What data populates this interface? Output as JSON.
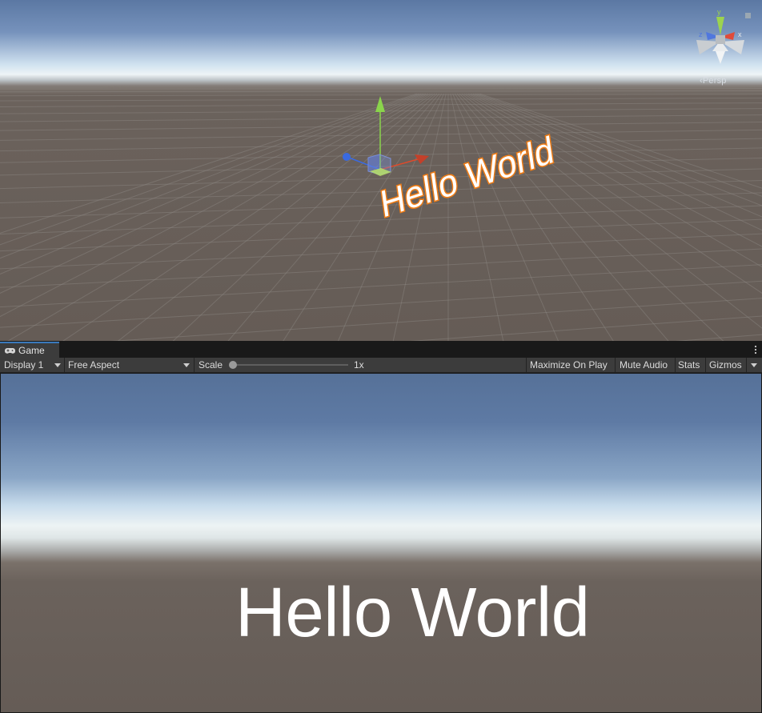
{
  "scene": {
    "hello_text": "Hello World",
    "persp_label": "‹Persp",
    "gizmo_axes": {
      "y": "y",
      "z": "z",
      "x": "x"
    },
    "colors": {
      "x_axis": "#e04a2a",
      "y_axis": "#8ad44b",
      "z_axis": "#3a6ae0",
      "outline": "#ef7d16"
    }
  },
  "tabbar": {
    "tab_label": "Game",
    "tab_icon": "gamepad-icon",
    "menu_icon": "kebab-menu-icon"
  },
  "toolbar": {
    "display": "Display 1",
    "aspect": "Free Aspect",
    "scale_label": "Scale",
    "scale_value": "1x",
    "maximize": "Maximize On Play",
    "mute": "Mute Audio",
    "stats": "Stats",
    "gizmos": "Gizmos"
  },
  "game": {
    "hello_text": "Hello World"
  }
}
